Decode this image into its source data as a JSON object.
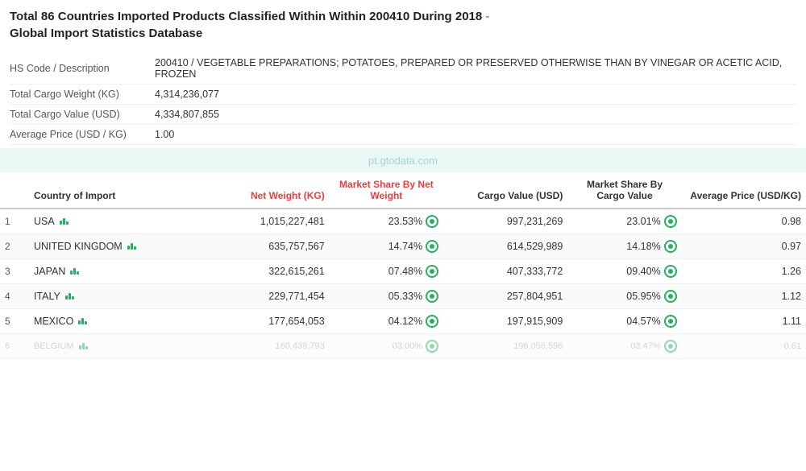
{
  "header": {
    "title_main": "Total 86 Countries Imported Products Classified Within Within 200410 During 2018",
    "title_sub": "Global Import Statistics Database",
    "dash": " - "
  },
  "info": {
    "hs_code_label": "HS Code / Description",
    "hs_code_value": "200410 / VEGETABLE PREPARATIONS; POTATOES, PREPARED OR PRESERVED OTHERWISE THAN BY VINEGAR OR ACETIC ACID, FROZEN",
    "cargo_weight_label": "Total Cargo Weight (KG)",
    "cargo_weight_value": "4,314,236,077",
    "cargo_value_label": "Total Cargo Value (USD)",
    "cargo_value_value": "4,334,807,855",
    "avg_price_label": "Average Price (USD / KG)",
    "avg_price_value": "1.00"
  },
  "watermark": "pt.gtodata.com",
  "table": {
    "headers": {
      "no": "",
      "country": "Country of Import",
      "net_weight": "Net Weight (KG)",
      "market_share_nw": "Market Share By Net Weight",
      "cargo_value": "Cargo Value (USD)",
      "market_share_cv": "Market Share By Cargo Value",
      "avg_price": "Average Price (USD/KG)"
    },
    "rows": [
      {
        "no": 1,
        "country": "USA",
        "net_weight": "1,015,227,481",
        "market_share_nw": "23.53%",
        "cargo_value": "997,231,269",
        "market_share_cv": "23.01%",
        "avg_price": "0.98"
      },
      {
        "no": 2,
        "country": "UNITED KINGDOM",
        "net_weight": "635,757,567",
        "market_share_nw": "14.74%",
        "cargo_value": "614,529,989",
        "market_share_cv": "14.18%",
        "avg_price": "0.97"
      },
      {
        "no": 3,
        "country": "JAPAN",
        "net_weight": "322,615,261",
        "market_share_nw": "07.48%",
        "cargo_value": "407,333,772",
        "market_share_cv": "09.40%",
        "avg_price": "1.26"
      },
      {
        "no": 4,
        "country": "ITALY",
        "net_weight": "229,771,454",
        "market_share_nw": "05.33%",
        "cargo_value": "257,804,951",
        "market_share_cv": "05.95%",
        "avg_price": "1.12"
      },
      {
        "no": 5,
        "country": "MEXICO",
        "net_weight": "177,654,053",
        "market_share_nw": "04.12%",
        "cargo_value": "197,915,909",
        "market_share_cv": "04.57%",
        "avg_price": "1.11"
      },
      {
        "no": 6,
        "country": "BELGIUM",
        "net_weight": "160,439,793",
        "market_share_nw": "03.00%",
        "cargo_value": "196,056,596",
        "market_share_cv": "03.47%",
        "avg_price": "0.61"
      }
    ]
  }
}
